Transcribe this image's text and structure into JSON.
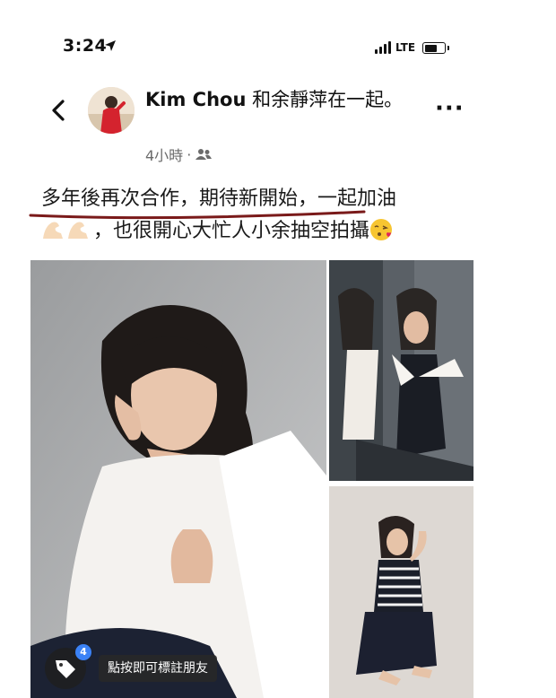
{
  "status_bar": {
    "time": "3:24",
    "network": "LTE",
    "battery_level": 0.75
  },
  "post": {
    "author": "Kim Chou",
    "with_text": " 和余靜萍在一起。",
    "time_ago": "4小時",
    "separator": " · ",
    "audience_icon": "friends-icon",
    "text_line1": "多年後再次合作，期待新開始，一起加油",
    "text_line2": "，也很開心大忙人小余抽空拍攝",
    "emojis": [
      "flexed-biceps",
      "flexed-biceps",
      "face-blowing-kiss"
    ]
  },
  "photos": {
    "tag_count": "4",
    "tag_hint": "點按即可標註朋友"
  },
  "colors": {
    "underline": "#7a1a1a",
    "tag_badge": "#3b82f6",
    "secondary_text": "#6b6b6b"
  }
}
